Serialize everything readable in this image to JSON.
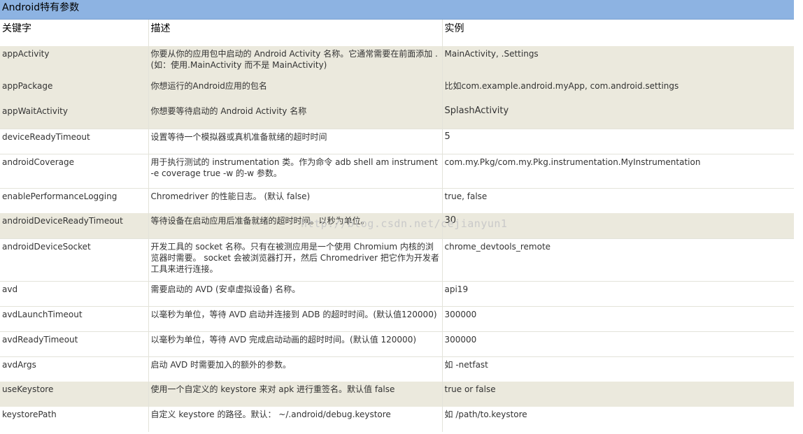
{
  "title": "Android特有参数",
  "headers": [
    "关键字",
    "描述",
    "实例"
  ],
  "rows": [
    {
      "key": "appActivity",
      "desc": "你要从你的应用包中启动的 Android Activity 名称。它通常需要在前面添加 . (如：使用.MainActivity 而不是 MainActivity)",
      "example": "MainActivity, .Settings"
    },
    {
      "key": "appPackage",
      "desc": "你想运行的Android应用的包名",
      "example": "比如com.example.android.myApp, com.android.settings"
    },
    {
      "key": "appWaitActivity",
      "desc": "你想要等待启动的 Android Activity 名称",
      "example": "SplashActivity"
    },
    {
      "key": "deviceReadyTimeout",
      "desc": "设置等待一个模拟器或真机准备就绪的超时时间",
      "example": "5"
    },
    {
      "key": "androidCoverage",
      "desc": "用于执行测试的 instrumentation 类。作为命令 adb shell am instrument -e coverage true -w 的-w 参数。",
      "example": "com.my.Pkg/com.my.Pkg.instrumentation.MyInstrumentation"
    },
    {
      "key": "enablePerformanceLogging",
      "desc": "Chromedriver 的性能日志。 (默认 false)",
      "example": "true, false"
    },
    {
      "key": "androidDeviceReadyTimeout",
      "desc": "等待设备在启动应用后准备就绪的超时时间。以秒为单位。",
      "example": "30"
    },
    {
      "key": "androidDeviceSocket",
      "desc": "开发工具的 socket 名称。只有在被测应用是一个使用 Chromium 内核的浏览器时需要。 socket 会被浏览器打开，然后 Chromedriver 把它作为开发者工具来进行连接。",
      "example": "chrome_devtools_remote"
    },
    {
      "key": "avd",
      "desc": "需要启动的 AVD (安卓虚拟设备) 名称。",
      "example": "api19"
    },
    {
      "key": "avdLaunchTimeout",
      "desc": "以毫秒为单位，等待 AVD 启动并连接到 ADB 的超时时间。(默认值120000)",
      "example": "300000"
    },
    {
      "key": "avdReadyTimeout",
      "desc": "以毫秒为单位，等待 AVD 完成启动动画的超时时间。(默认值 120000)",
      "example": "300000"
    },
    {
      "key": "avdArgs",
      "desc": "启动 AVD 时需要加入的额外的参数。",
      "example": "如 -netfast"
    },
    {
      "key": "useKeystore",
      "desc": "使用一个自定义的 keystore 来对 apk 进行重签名。默认值 false",
      "example": "true or false"
    },
    {
      "key": "keystorePath",
      "desc": "自定义 keystore 的路径。默认： ~/.android/debug.keystore",
      "example": "如 /path/to.keystore"
    }
  ],
  "watermark": "http://blog.csdn.net/cejianyun1"
}
